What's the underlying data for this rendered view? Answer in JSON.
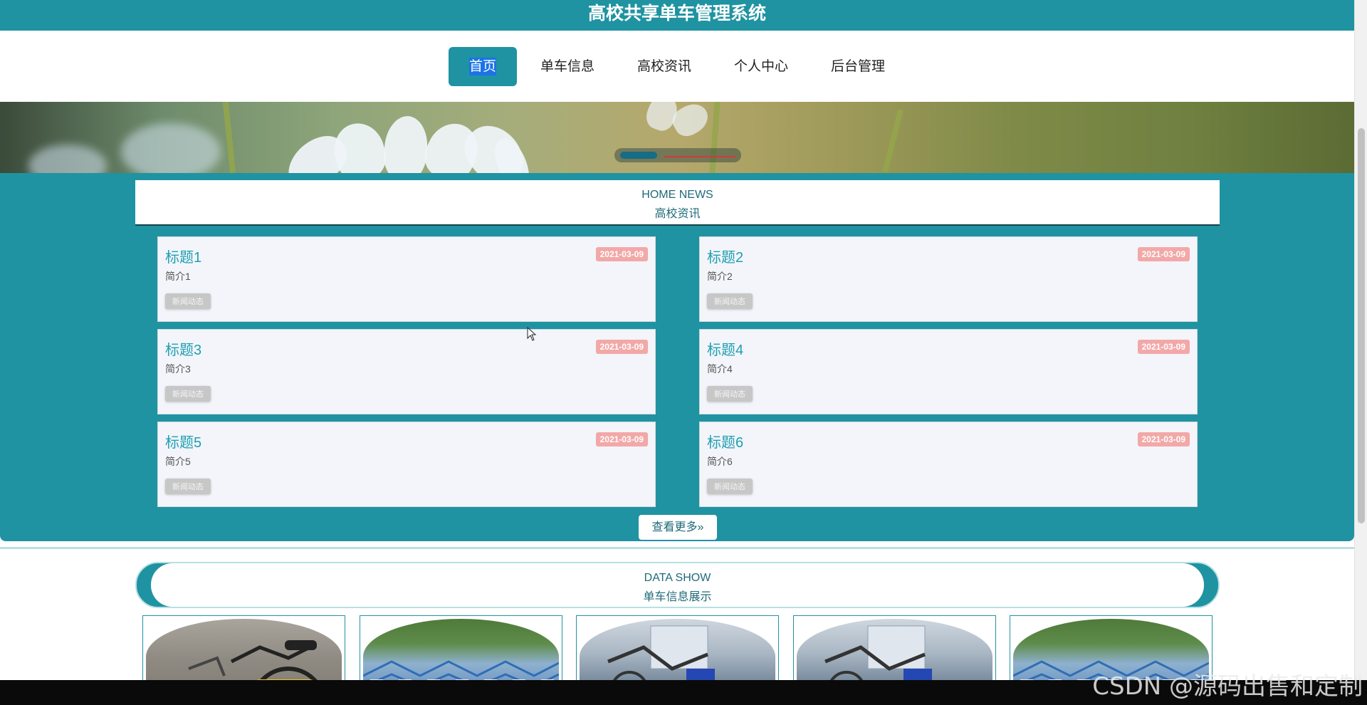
{
  "header": {
    "title": "高校共享单车管理系统"
  },
  "nav": {
    "items": [
      {
        "label": "首页",
        "active": true
      },
      {
        "label": "单车信息",
        "active": false
      },
      {
        "label": "高校资讯",
        "active": false
      },
      {
        "label": "个人中心",
        "active": false
      },
      {
        "label": "后台管理",
        "active": false
      }
    ]
  },
  "news": {
    "heading_en": "HOME NEWS",
    "heading_cn": "高校资讯",
    "items": [
      {
        "title": "标题1",
        "date": "2021-03-09",
        "desc": "简介1",
        "tag": "新闻动态"
      },
      {
        "title": "标题2",
        "date": "2021-03-09",
        "desc": "简介2",
        "tag": "新闻动态"
      },
      {
        "title": "标题3",
        "date": "2021-03-09",
        "desc": "简介3",
        "tag": "新闻动态"
      },
      {
        "title": "标题4",
        "date": "2021-03-09",
        "desc": "简介4",
        "tag": "新闻动态"
      },
      {
        "title": "标题5",
        "date": "2021-03-09",
        "desc": "简介5",
        "tag": "新闻动态"
      },
      {
        "title": "标题6",
        "date": "2021-03-09",
        "desc": "简介6",
        "tag": "新闻动态"
      }
    ],
    "more_label": "查看更多»"
  },
  "data_show": {
    "heading_en": "DATA SHOW",
    "heading_cn": "单车信息展示"
  },
  "watermark": "CSDN @源码出售和定制",
  "colors": {
    "primary": "#1f93a1",
    "date_badge": "#f3a8a8",
    "title_link": "#1f9fb0"
  }
}
